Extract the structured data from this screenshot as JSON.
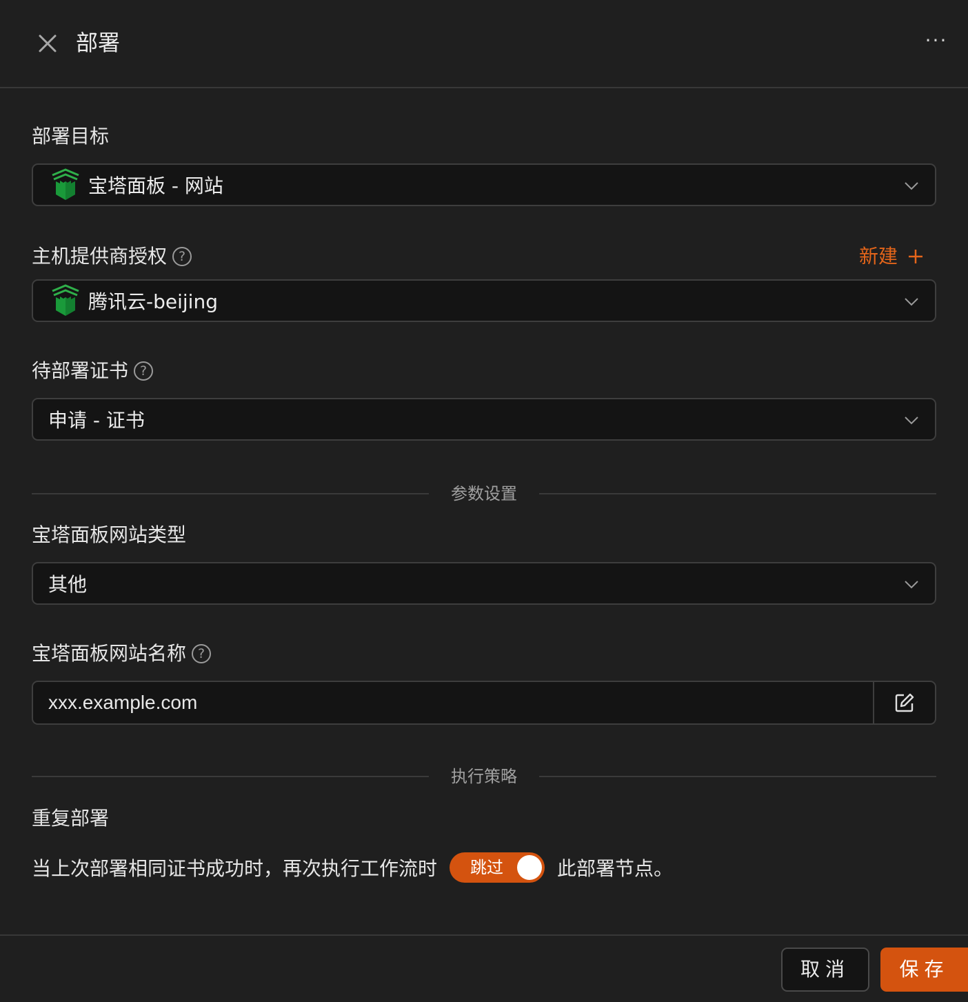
{
  "header": {
    "title": "部署",
    "more_label": "···"
  },
  "form": {
    "target": {
      "label": "部署目标",
      "value": "宝塔面板 - 网站",
      "icon": "baota-logo-icon"
    },
    "provider": {
      "label": "主机提供商授权",
      "new_label": "新建",
      "value": "腾讯云-beijing",
      "icon": "baota-logo-icon"
    },
    "cert": {
      "label": "待部署证书",
      "value": "申请 - 证书"
    },
    "params_divider": "参数设置",
    "site_type": {
      "label": "宝塔面板网站类型",
      "value": "其他"
    },
    "site_name": {
      "label": "宝塔面板网站名称",
      "value": "xxx.example.com"
    },
    "strategy_divider": "执行策略",
    "repeat": {
      "label": "重复部署",
      "text_before": "当上次部署相同证书成功时，再次执行工作流时",
      "toggle_label": "跳过",
      "toggle_on": true,
      "text_after": "此部署节点。"
    }
  },
  "footer": {
    "cancel_label": "取消",
    "save_label": "保存"
  },
  "colors": {
    "accent": "#d4530f",
    "link": "#e4651a",
    "background": "#1f1f1f",
    "logo_green": "#1a9a3a"
  }
}
